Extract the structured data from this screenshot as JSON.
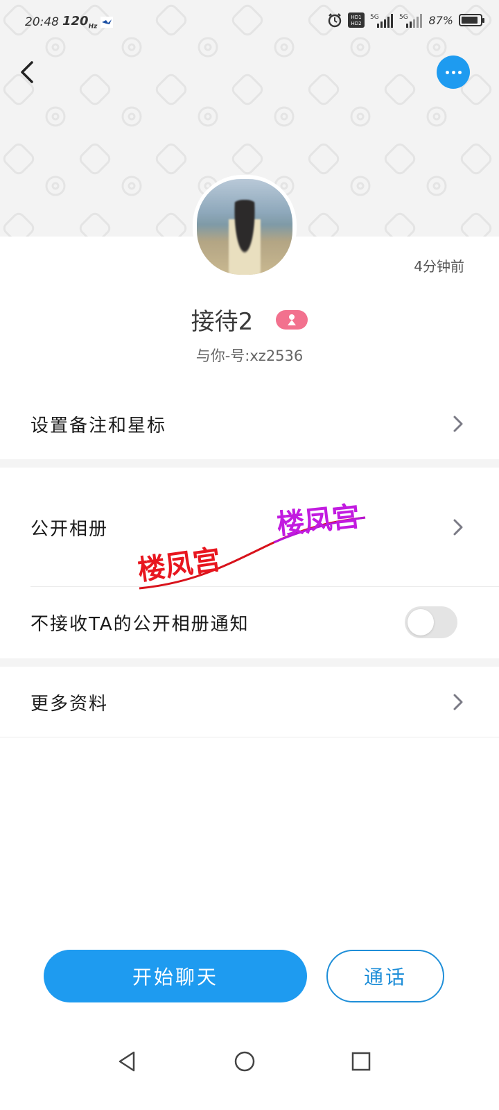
{
  "status_bar": {
    "time": "20:48",
    "refresh_rate": "120",
    "refresh_unit": "Hz",
    "hd1": "HD1",
    "hd2": "HD2",
    "net1": "5G",
    "net2": "5G",
    "battery_pct": "87%",
    "battery_level": 0.87
  },
  "header": {
    "back_icon": "chevron-left-icon",
    "more_icon": "more-horizontal-icon",
    "accent_color": "#1e9bf0"
  },
  "profile": {
    "last_active": "4分钟前",
    "name": "接待2",
    "gender_icon": "female-icon",
    "relation": "与你-号:xz2536"
  },
  "menu": {
    "remark": "设置备注和星标",
    "public_album": "公开相册",
    "mute_album_notice": "不接收TA的公开相册通知",
    "mute_album_notice_on": false,
    "more_info": "更多资料"
  },
  "watermark": {
    "text_1": "楼凤宫",
    "text_2": "楼凤宫"
  },
  "actions": {
    "start_chat": "开始聊天",
    "call": "通话"
  },
  "nav": {
    "back_icon": "triangle-back-icon",
    "home_icon": "circle-home-icon",
    "recents_icon": "square-recents-icon"
  }
}
